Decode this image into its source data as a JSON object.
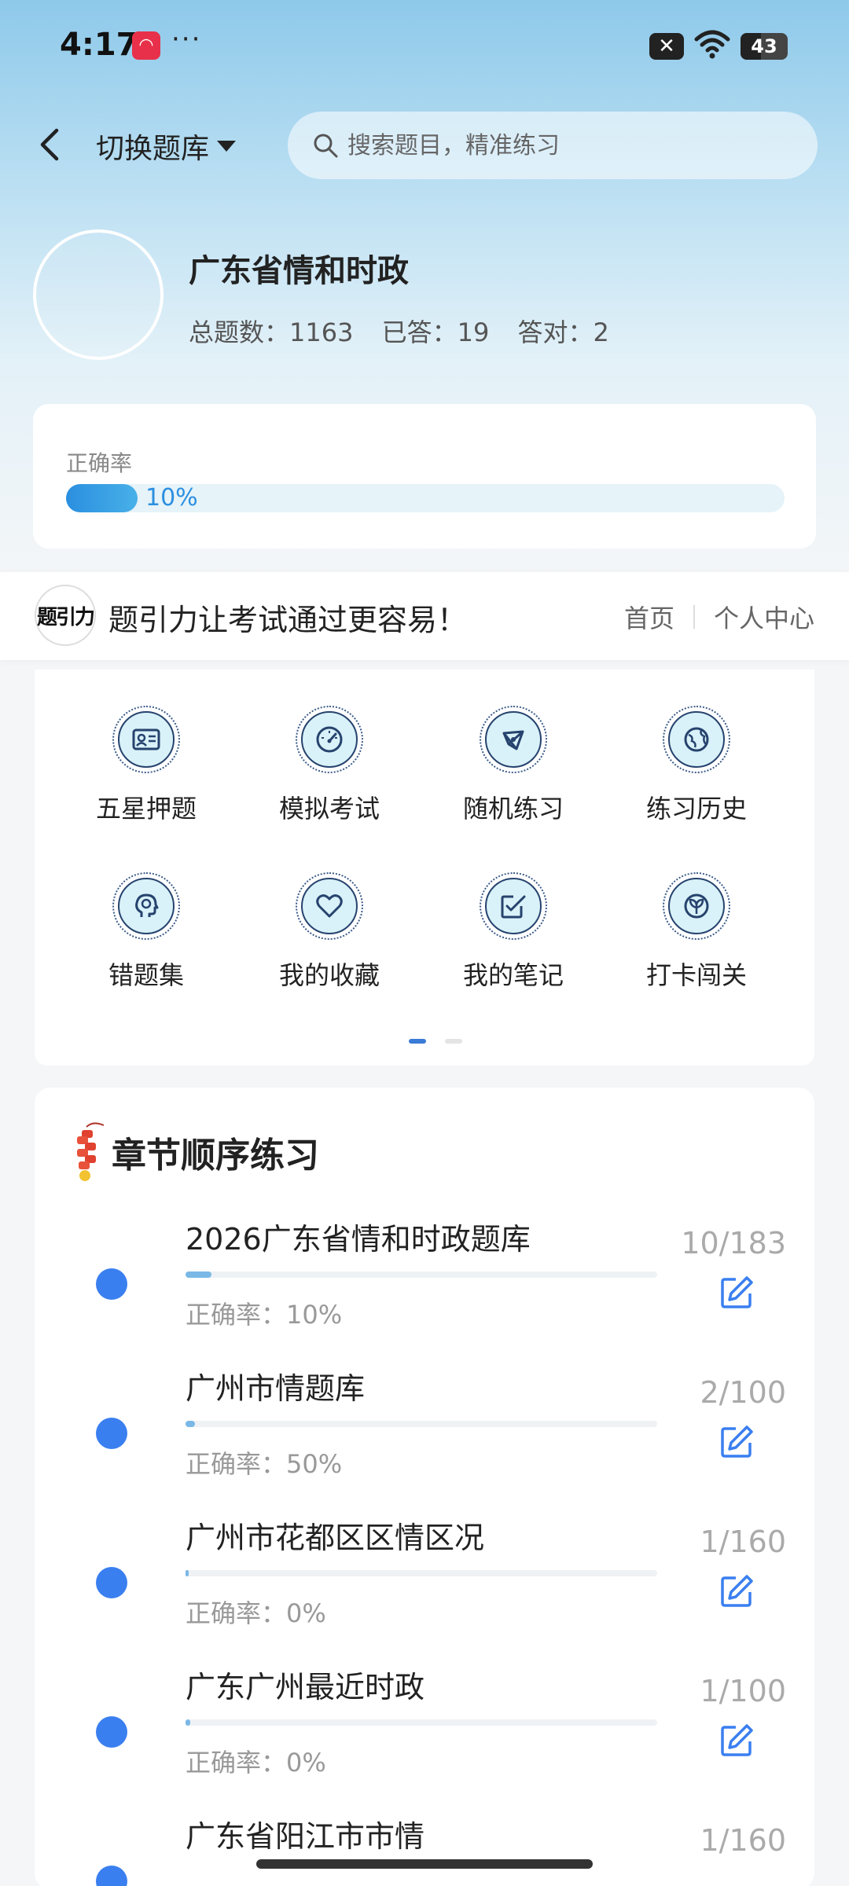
{
  "status_bar": {
    "time": "4:17",
    "battery": "43",
    "more": "···"
  },
  "header": {
    "switch_label": "切换题库",
    "search_placeholder": "搜索题目，精准练习"
  },
  "bank": {
    "title": "广东省情和时政",
    "total": "总题数：1163",
    "answered": "已答：19",
    "correct": "答对：2"
  },
  "accuracy": {
    "label": "正确率",
    "percent_text": "10%",
    "value": 0.1
  },
  "banner": {
    "logo": "题引力",
    "slogan": "题引力让考试通过更容易！",
    "nav_home": "首页",
    "nav_profile": "个人中心"
  },
  "grid": {
    "items": [
      {
        "label": "五星押题",
        "icon": "id-card-icon"
      },
      {
        "label": "模拟考试",
        "icon": "speedometer-icon"
      },
      {
        "label": "随机练习",
        "icon": "network-icon"
      },
      {
        "label": "练习历史",
        "icon": "globe-icon"
      },
      {
        "label": "错题集",
        "icon": "head-icon"
      },
      {
        "label": "我的收藏",
        "icon": "heart-icon"
      },
      {
        "label": "我的笔记",
        "icon": "note-check-icon"
      },
      {
        "label": "打卡闯关",
        "icon": "sprout-icon"
      }
    ],
    "page": 1,
    "pages": 2
  },
  "chapters": {
    "title": "章节顺序练习",
    "items": [
      {
        "name": "2026广东省情和时政题库",
        "accuracy": "正确率：10%",
        "count": "10/183",
        "progress": 0.055
      },
      {
        "name": "广州市情题库",
        "accuracy": "正确率：50%",
        "count": "2/100",
        "progress": 0.02
      },
      {
        "name": "广州市花都区区情区况",
        "accuracy": "正确率：0%",
        "count": "1/160",
        "progress": 0.006
      },
      {
        "name": "广东广州最近时政",
        "accuracy": "正确率：0%",
        "count": "1/100",
        "progress": 0.01
      },
      {
        "name": "广东省阳江市市情",
        "accuracy": "",
        "count": "1/160",
        "progress": 0.006
      }
    ]
  },
  "colors": {
    "accent": "#3a7ff0",
    "accuracy_fill": "#2b8fe0",
    "icon_bg": "#d9f1f8",
    "icon_stroke": "#26436e"
  }
}
